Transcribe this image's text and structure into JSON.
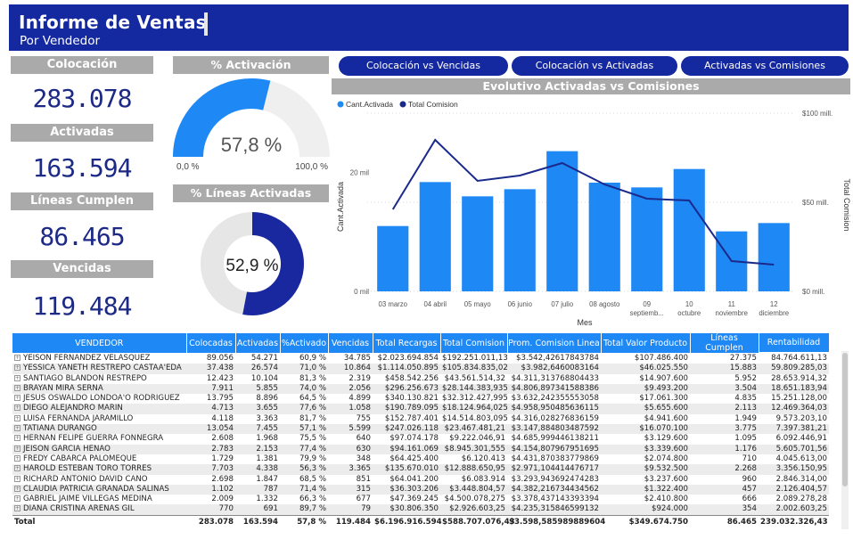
{
  "header": {
    "title": "Informe de Ventas",
    "subtitle": "Por Vendedor"
  },
  "kpis": [
    {
      "label": "Colocación",
      "value": "283.078"
    },
    {
      "label": "Activadas",
      "value": "163.594"
    },
    {
      "label": "Líneas Cumplen",
      "value": "86.465"
    },
    {
      "label": "Vencidas",
      "value": "119.484"
    }
  ],
  "gauge": {
    "label": "% Activación",
    "value_text": "57,8 %",
    "min": "0,0 %",
    "max": "100,0 %",
    "fraction": 0.578,
    "color": "#1e88f5",
    "track": "#efefef"
  },
  "donut": {
    "label": "% Líneas Activadas",
    "value_text": "52,9 %",
    "fraction": 0.529,
    "color": "#1a28a0",
    "track": "#e6e6e6"
  },
  "nav": [
    {
      "label": "Colocación vs Vencidas"
    },
    {
      "label": "Colocación vs Activadas"
    },
    {
      "label": "Activadas vs Comisiones"
    }
  ],
  "chart_data": {
    "type": "bar",
    "title": "Evolutivo Activadas vs Comisiones",
    "xlabel": "Mes",
    "ylabel": "Cant.Activada",
    "y2label": "Total Comision",
    "categories": [
      "03 marzo",
      "04 abril",
      "05 mayo",
      "06 junio",
      "07 julio",
      "08 agosto",
      "09 septiemb...",
      "10 octubre",
      "11 noviembre",
      "12 diciembre"
    ],
    "y_ticks": [
      "0 mil",
      "20 mil"
    ],
    "y2_ticks": [
      "$0 mill.",
      "$50 mill.",
      "$100 mill."
    ],
    "ylim": [
      0,
      30000
    ],
    "y2lim": [
      0,
      100
    ],
    "series": [
      {
        "name": "Cant.Activada",
        "type": "bar",
        "color": "#1e88f5",
        "values": [
          11000,
          18400,
          16000,
          17200,
          23600,
          18300,
          17500,
          20600,
          10100,
          11500
        ]
      },
      {
        "name": "Total Comision",
        "type": "line",
        "color": "#1a2a8c",
        "values": [
          46,
          85,
          62,
          65,
          72,
          60,
          52,
          51,
          17,
          15
        ]
      }
    ],
    "legend": "top-left",
    "grid": true
  },
  "table": {
    "columns": [
      "VENDEDOR",
      "Colocadas",
      "Activadas",
      "%Activado",
      "Vencidas",
      "Total Recargas",
      "Total Comision",
      "Prom. Comision Linea",
      "Total Valor Producto",
      "Líneas Cumplen",
      "Rentabilidad"
    ],
    "rows": [
      [
        "YEISON FERNANDEZ VELASQUEZ",
        "89.056",
        "54.271",
        "60,9 %",
        "34.785",
        "$2.023.694.854",
        "$192.251.011,13",
        "$3.542,42617843784",
        "$107.486.400",
        "27.375",
        "84.764.611,13"
      ],
      [
        "YESSICA YANETH RESTREPO CASTAÃ'EDA",
        "37.438",
        "26.574",
        "71,0 %",
        "10.864",
        "$1.114.050.895",
        "$105.834.835,025",
        "$3.982,6460083164",
        "$46.025.550",
        "15.883",
        "59.809.285,03"
      ],
      [
        "SANTIAGO BLANDON RESTREPO",
        "12.423",
        "10.104",
        "81,3 %",
        "2.319",
        "$458.542.256",
        "$43.561.514,32",
        "$4.311,313768804433",
        "$14.907.600",
        "5.952",
        "28.653.914,32"
      ],
      [
        "BRAYAN MIRA SERNA",
        "7.911",
        "5.855",
        "74,0 %",
        "2.056",
        "$296.256.673",
        "$28.144.383,935",
        "$4.806,897341588386",
        "$9.493.200",
        "3.504",
        "18.651.183,94"
      ],
      [
        "JESUS OSWALDO LONDOÃ'O RODRIGUEZ",
        "13.795",
        "8.896",
        "64,5 %",
        "4.899",
        "$340.130.821",
        "$32.312.427,995",
        "$3.632,242355553058",
        "$17.061.300",
        "4.835",
        "15.251.128,00"
      ],
      [
        "DIEGO ALEJANDRO MARIN",
        "4.713",
        "3.655",
        "77,6 %",
        "1.058",
        "$190.789.095",
        "$18.124.964,025",
        "$4.958,950485636115",
        "$5.655.600",
        "2.113",
        "12.469.364,03"
      ],
      [
        "LUISA FERNANDA JARAMILLO",
        "4.118",
        "3.363",
        "81,7 %",
        "755",
        "$152.787.401",
        "$14.514.803,095",
        "$4.316,028276836159",
        "$4.941.600",
        "1.949",
        "9.573.203,10"
      ],
      [
        "TATIANA DURANGO",
        "13.054",
        "7.455",
        "57,1 %",
        "5.599",
        "$247.026.118",
        "$23.467.481,21",
        "$3.147,884803487592",
        "$16.070.100",
        "3.775",
        "7.397.381,21"
      ],
      [
        "HERNAN FELIPE GUERRA FONNEGRA",
        "2.608",
        "1.968",
        "75,5 %",
        "640",
        "$97.074.178",
        "$9.222.046,91",
        "$4.685,999446138211",
        "$3.129.600",
        "1.095",
        "6.092.446,91"
      ],
      [
        "JEISON GARCIA HENAO",
        "2.783",
        "2.153",
        "77,4 %",
        "630",
        "$94.161.069",
        "$8.945.301,555",
        "$4.154,807967951695",
        "$3.339.600",
        "1.176",
        "5.605.701,56"
      ],
      [
        "FREDY CABARCA PALOMEQUE",
        "1.729",
        "1.381",
        "79,9 %",
        "348",
        "$64.425.400",
        "$6.120.413",
        "$4.431,870383779869",
        "$2.074.800",
        "710",
        "4.045.613,00"
      ],
      [
        "HAROLD ESTEBAN TORO TORRES",
        "7.703",
        "4.338",
        "56,3 %",
        "3.365",
        "$135.670.010",
        "$12.888.650,95",
        "$2.971,104414476717",
        "$9.532.500",
        "2.268",
        "3.356.150,95"
      ],
      [
        "RICHARD ANTONIO DAVID CANO",
        "2.698",
        "1.847",
        "68,5 %",
        "851",
        "$64.041.200",
        "$6.083.914",
        "$3.293,943692474283",
        "$3.237.600",
        "960",
        "2.846.314,00"
      ],
      [
        "CLAUDIA PATRICIA GRANADA SALINAS",
        "1.102",
        "787",
        "71,4 %",
        "315",
        "$36.303.206",
        "$3.448.804,57",
        "$4.382,216734434562",
        "$1.322.400",
        "457",
        "2.126.404,57"
      ],
      [
        "GABRIEL JAIME VILLEGAS MEDINA",
        "2.009",
        "1.332",
        "66,3 %",
        "677",
        "$47.369.245",
        "$4.500.078,275",
        "$3.378,437143393394",
        "$2.410.800",
        "666",
        "2.089.278,28"
      ],
      [
        "DIANA CRISTINA ARENAS GIL",
        "770",
        "691",
        "89,7 %",
        "79",
        "$30.806.350",
        "$2.926.603,25",
        "$4.235,315846599132",
        "$924.000",
        "354",
        "2.002.603,25"
      ]
    ],
    "total": [
      "Total",
      "283.078",
      "163.594",
      "57,8 %",
      "119.484",
      "$6.196.916.594",
      "$588.707.076,43",
      "$3.598,585989889604",
      "$349.674.750",
      "86.465",
      "239.032.326,43"
    ]
  }
}
